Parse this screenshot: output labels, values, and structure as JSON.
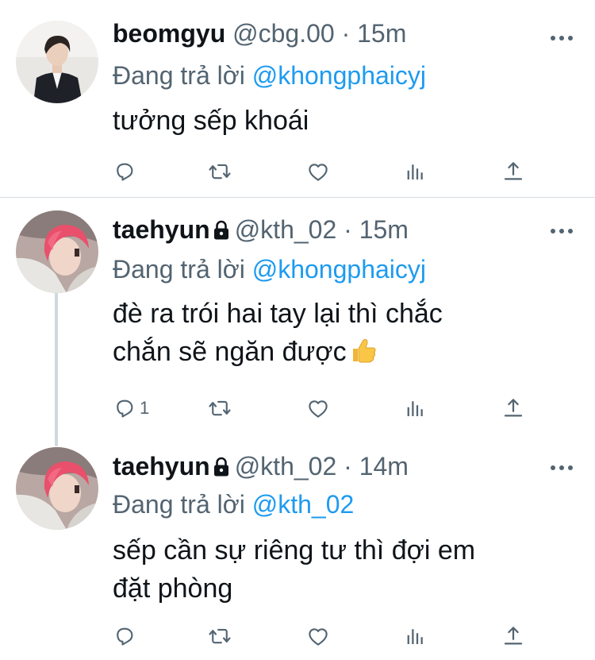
{
  "tweets": [
    {
      "name": "beomgyu",
      "handle": "@cbg.00",
      "separator": "·",
      "time": "15m",
      "replying_label": "Đang trả lời",
      "replying_to": "@khongphaicyj",
      "text": "tưởng sếp khoái",
      "reply_count": "",
      "locked": false
    },
    {
      "name": "taehyun",
      "handle": "@kth_02",
      "separator": "·",
      "time": "15m",
      "replying_label": "Đang trả lời",
      "replying_to": "@khongphaicyj",
      "text_line1": "đè ra trói hai tay lại thì chắc",
      "text_line2": "chắn sẽ ngăn được",
      "reply_count": "1",
      "locked": true
    },
    {
      "name": "taehyun",
      "handle": "@kth_02",
      "separator": "·",
      "time": "14m",
      "replying_label": "Đang trả lời",
      "replying_to": "@kth_02",
      "text_line1": "sếp cần sự riêng tư thì đợi em",
      "text_line2": "đặt phòng",
      "reply_count": "",
      "locked": true
    }
  ],
  "icons": [
    "reply-icon",
    "retweet-icon",
    "like-icon",
    "analytics-icon",
    "share-icon",
    "more-icon",
    "lock-icon",
    "thumbs-up-emoji"
  ],
  "colors": {
    "text": "#0f1419",
    "secondary": "#536471",
    "link": "#1d9bf0",
    "thread_line": "#cfd9de",
    "divider": "#d6dde2"
  }
}
